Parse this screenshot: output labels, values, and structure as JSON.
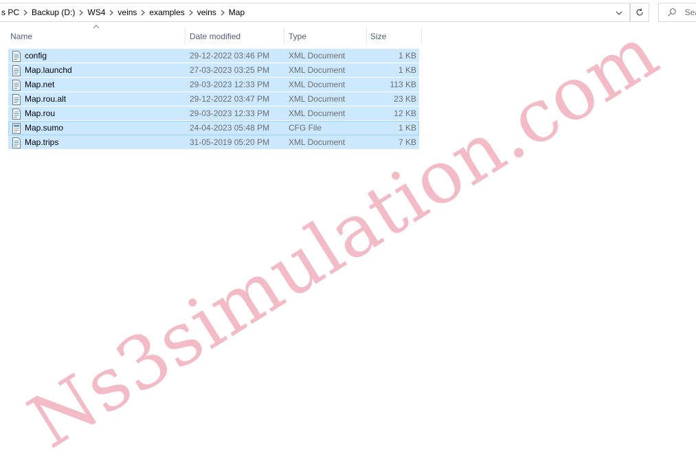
{
  "address_bar": {
    "breadcrumbs": [
      "s PC",
      "Backup (D:)",
      "WS4",
      "veins",
      "examples",
      "veins",
      "Map"
    ]
  },
  "search": {
    "placeholder": "Sea"
  },
  "columns": {
    "name": "Name",
    "date": "Date modified",
    "type": "Type",
    "size": "Size"
  },
  "files": [
    {
      "name": "config",
      "date": "29-12-2022 03:46 PM",
      "type": "XML Document",
      "size": "1 KB",
      "icon": "xml-document-icon"
    },
    {
      "name": "Map.launchd",
      "date": "27-03-2023 03:25 PM",
      "type": "XML Document",
      "size": "1 KB",
      "icon": "xml-document-icon"
    },
    {
      "name": "Map.net",
      "date": "29-03-2023 12:33 PM",
      "type": "XML Document",
      "size": "113 KB",
      "icon": "xml-document-icon"
    },
    {
      "name": "Map.rou.alt",
      "date": "29-12-2022 03:47 PM",
      "type": "XML Document",
      "size": "23 KB",
      "icon": "xml-document-icon"
    },
    {
      "name": "Map.rou",
      "date": "29-03-2023 12:33 PM",
      "type": "XML Document",
      "size": "12 KB",
      "icon": "xml-document-icon"
    },
    {
      "name": "Map.sumo",
      "date": "24-04-2023 05:48 PM",
      "type": "CFG File",
      "size": "1 KB",
      "icon": "cfg-file-icon"
    },
    {
      "name": "Map.trips",
      "date": "31-05-2019 05:20 PM",
      "type": "XML Document",
      "size": "7 KB",
      "icon": "xml-document-icon"
    }
  ],
  "watermark": "Ns3simulation.com",
  "colors": {
    "selection": "#cce8ff",
    "focus_border": "#99d1ff",
    "header_text": "#4c607a",
    "watermark": "#f2b8c3"
  }
}
